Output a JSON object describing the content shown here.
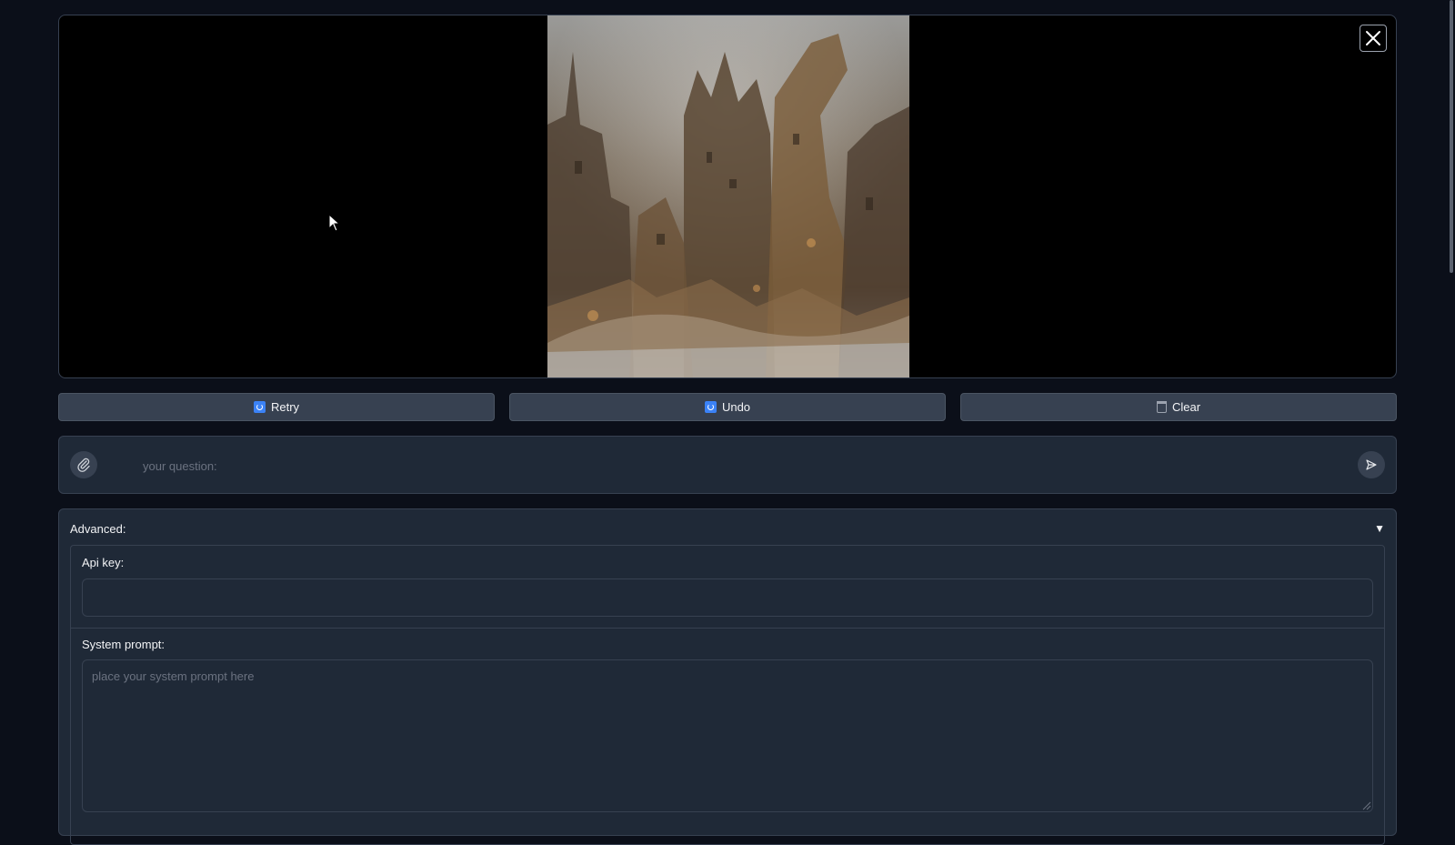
{
  "preview": {
    "close_label": "Close",
    "image_alt": "Steampunk ruined city artwork"
  },
  "actions": {
    "retry_label": "Retry",
    "undo_label": "Undo",
    "clear_label": "Clear"
  },
  "question": {
    "placeholder": "your question:"
  },
  "advanced": {
    "title": "Advanced:",
    "caret": "▼",
    "api_key_label": "Api key:",
    "api_key_value": "",
    "system_prompt_label": "System prompt:",
    "system_prompt_placeholder": "place your system prompt here"
  },
  "colors": {
    "background": "#0b0f19",
    "panel": "#1f2937",
    "border": "#374151",
    "button": "#374151",
    "accent_blue": "#3b82f6"
  },
  "icons": {
    "close": "close-icon",
    "cursor": "cursor-icon",
    "retry": "refresh-icon",
    "undo": "undo-icon",
    "clear": "trash-icon",
    "attach": "paperclip-icon",
    "send": "send-icon",
    "caret": "chevron-down-icon"
  }
}
